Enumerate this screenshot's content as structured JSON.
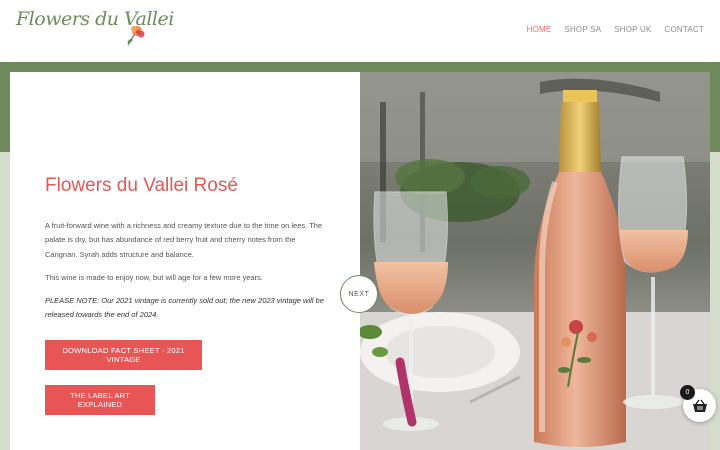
{
  "header": {
    "logo_text": "Flowers du Vallei",
    "nav": [
      {
        "label": "HOME",
        "active": true
      },
      {
        "label": "SHOP SA",
        "active": false
      },
      {
        "label": "SHOP UK",
        "active": false
      },
      {
        "label": "CONTACT",
        "active": false
      }
    ]
  },
  "main": {
    "title": "Flowers du Vallei Rosé",
    "description": "A fruit-forward wine with a richness and creamy texture due to the time on lees. The palate is dry, but has abundance of red berry fruit and cherry notes from the Carignan. Syrah adds structure and balance.",
    "aging_note": "This wine is made to enjoy now, but will age for a few more years.",
    "please_note": "PLEASE NOTE: Our 2021 vintage is currently sold out; the new 2023 vintage will be released towards the end of 2024.",
    "buttons": {
      "fact_sheet": "DOWNLOAD FACT SHEET - 2021 VINTAGE",
      "label_art": "THE LABEL ART EXPLAINED"
    }
  },
  "slider": {
    "next_label": "NEXT"
  },
  "cart": {
    "count": "0",
    "icon": "basket-icon"
  },
  "colors": {
    "accent": "#e85555",
    "brand_green": "#6f8a5d",
    "sage": "#d4dccb"
  }
}
